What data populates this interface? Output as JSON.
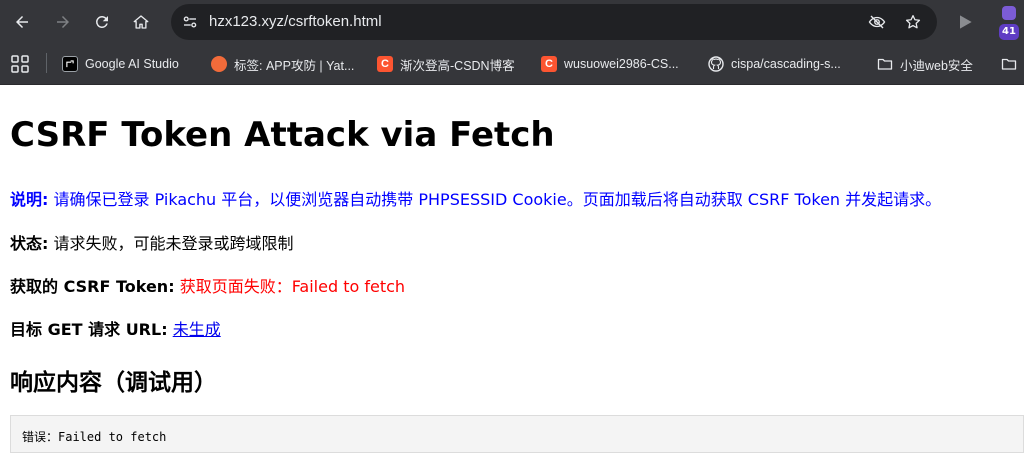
{
  "browser": {
    "url": "hzx123.xyz/csrftoken.html",
    "extension_badge": "41",
    "colors": {
      "chrome": "#35363a",
      "omnibox": "#202124",
      "badge": "#5f3dc4"
    }
  },
  "bookmarks": [
    {
      "label": "Google AI Studio",
      "icon": "google-ai-studio-icon"
    },
    {
      "label": "标签: APP攻防 | Yat...",
      "icon": "orange-circle-icon"
    },
    {
      "label": "渐次登高-CSDN博客",
      "icon": "csdn-icon"
    },
    {
      "label": "wusuowei2986-CS...",
      "icon": "csdn-icon"
    },
    {
      "label": "cispa/cascading-s...",
      "icon": "github-icon"
    },
    {
      "label": "小迪web安全",
      "icon": "folder-icon"
    }
  ],
  "page": {
    "title": "CSRF Token Attack via Fetch",
    "note_label": "说明:",
    "note_text": "请确保已登录 Pikachu 平台，以便浏览器自动携带 PHPSESSID Cookie。页面加载后将自动获取 CSRF Token 并发起请求。",
    "status_label": "状态:",
    "status_text": "请求失败，可能未登录或跨域限制",
    "token_label": "获取的 CSRF Token:",
    "token_value": "获取页面失败：Failed to fetch",
    "url_label": "目标 GET 请求 URL:",
    "url_value": "未生成",
    "response_heading": "响应内容（调试用）",
    "response_text": "错误：Failed to fetch"
  }
}
